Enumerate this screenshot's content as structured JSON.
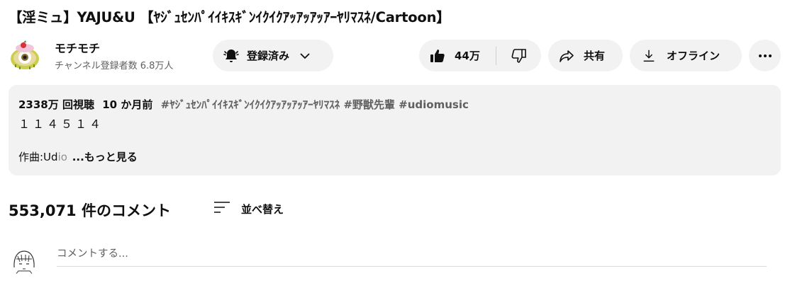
{
  "video": {
    "title": "【淫ミュ】YAJU&U 【ﾔｼﾞｭｾﾝﾊﾟｲｲｷｽｷﾞﾝｲｸｲｸｱｯｱｯｱｯｱｰﾔﾘﾏｽﾈ/Cartoon】"
  },
  "channel": {
    "name": "モチモチ",
    "subscribers": "チャンネル登録者数 6.8万人"
  },
  "actions": {
    "subscribed_label": "登録済み",
    "like_count": "44万",
    "share_label": "共有",
    "offline_label": "オフライン"
  },
  "description": {
    "views": "2338万 回視聴",
    "date": "10 か月前",
    "hashtags": "#ﾔｼﾞｭｾﾝﾊﾟｲｲｷｽｷﾞﾝｲｸｲｸｱｯｱｯｱｯｱｰﾔﾘﾏｽﾈ #野獣先輩 #udiomusic",
    "line1": "１１４５１４",
    "line2_start": "作曲:Ud",
    "line2_fade": "io",
    "more_link": "...もっと見る"
  },
  "comments": {
    "count": "553,071 件のコメント",
    "sort_label": "並べ替え",
    "placeholder": "コメントする..."
  },
  "icons": {
    "subscribed": "bell-icon",
    "chevron": "chevron-down-icon",
    "like": "thumbs-up-icon",
    "dislike": "thumbs-down-icon",
    "share": "share-icon",
    "offline": "download-icon",
    "more": "more-horizontal-icon",
    "sort": "sort-icon"
  }
}
